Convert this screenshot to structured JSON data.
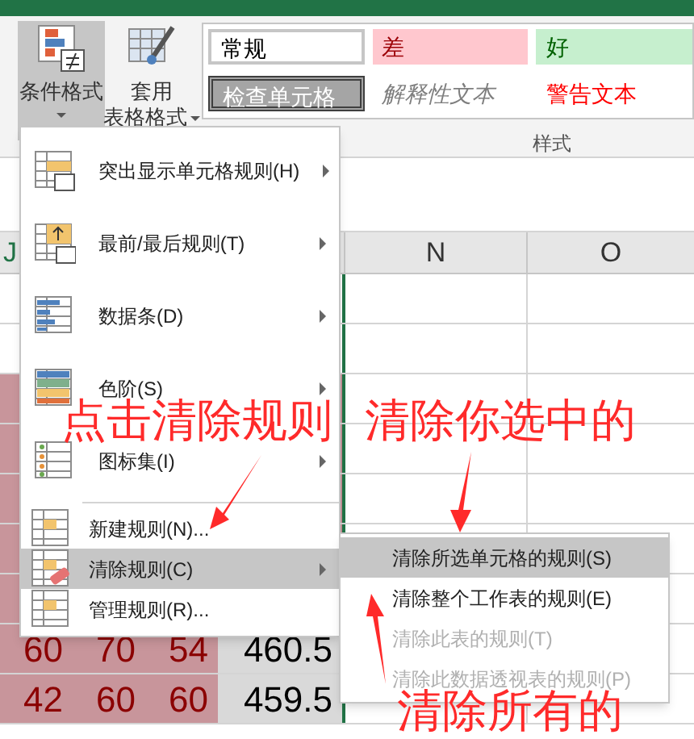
{
  "ribbon": {
    "buttons": [
      {
        "lines": [
          "条件格式"
        ],
        "selected": true,
        "caret": true
      },
      {
        "lines": [
          "套用",
          "表格格式"
        ],
        "selected": false,
        "caret": true
      }
    ],
    "styles": [
      {
        "label": "常规",
        "kind": "normal"
      },
      {
        "label": "差",
        "kind": "bad"
      },
      {
        "label": "好",
        "kind": "good"
      },
      {
        "label": "检查单元格",
        "kind": "check"
      },
      {
        "label": "解释性文本",
        "kind": "explanatory"
      },
      {
        "label": "警告文本",
        "kind": "warning"
      }
    ],
    "group_label": "样式"
  },
  "sheet": {
    "columns": [
      "J",
      "N",
      "O"
    ],
    "rows": [
      [
        "60",
        "70",
        "54",
        "460.5"
      ],
      [
        "42",
        "60",
        "60",
        "459.5"
      ]
    ]
  },
  "menu": {
    "items": [
      {
        "label": "突出显示单元格规则(H)",
        "submenu": true,
        "selected": false
      },
      {
        "label": "最前/最后规则(T)",
        "submenu": true,
        "selected": false
      },
      {
        "label": "数据条(D)",
        "submenu": true,
        "selected": false
      },
      {
        "label": "色阶(S)",
        "submenu": true,
        "selected": false
      },
      {
        "label": "图标集(I)",
        "submenu": true,
        "selected": false
      },
      {
        "label": "新建规则(N)...",
        "submenu": false,
        "selected": false
      },
      {
        "label": "清除规则(C)",
        "submenu": true,
        "selected": true
      },
      {
        "label": "管理规则(R)...",
        "submenu": false,
        "selected": false
      }
    ]
  },
  "submenu": {
    "items": [
      {
        "label": "清除所选单元格的规则(S)",
        "selected": true,
        "disabled": false
      },
      {
        "label": "清除整个工作表的规则(E)",
        "selected": false,
        "disabled": false
      },
      {
        "label": "清除此表的规则(T)",
        "selected": false,
        "disabled": true
      },
      {
        "label": "清除此数据透视表的规则(P)",
        "selected": false,
        "disabled": true
      }
    ]
  },
  "annotations": [
    "点击清除规则",
    "清除你选中的",
    "清除所有的"
  ]
}
